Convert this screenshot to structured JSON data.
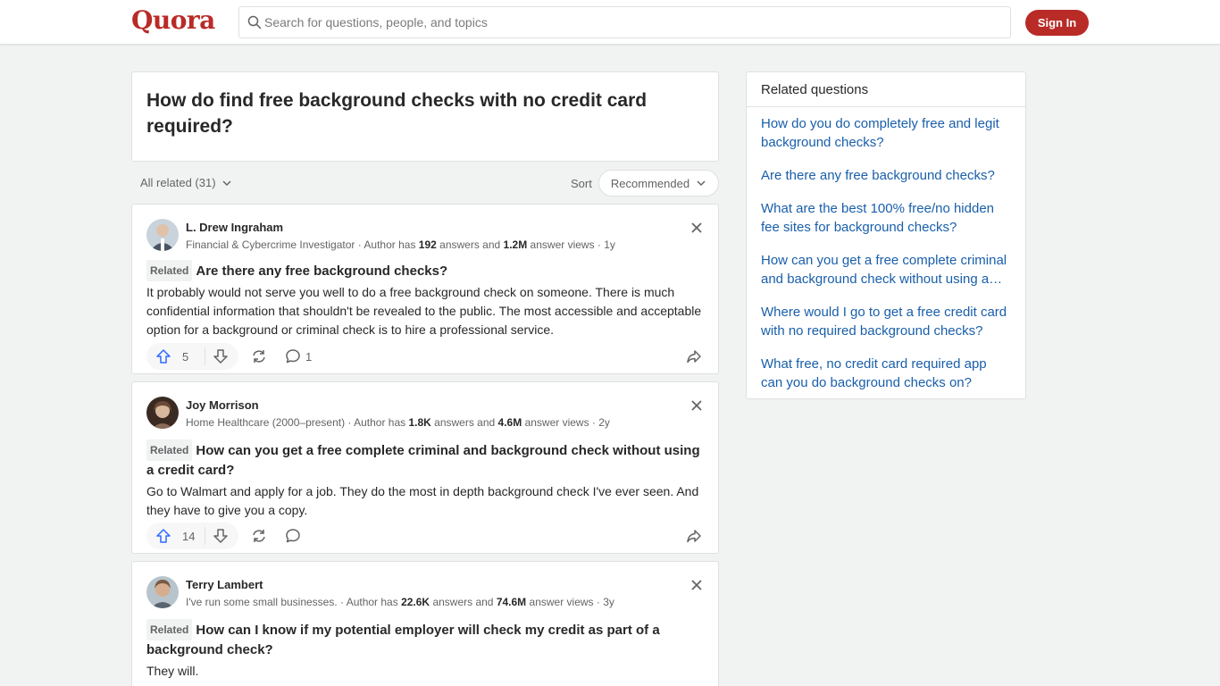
{
  "header": {
    "logo": "Quora",
    "search_placeholder": "Search for questions, people, and topics",
    "signin_label": "Sign In"
  },
  "question": {
    "title": "How do find free background checks with no credit card required?"
  },
  "filters": {
    "all_related": "All related (31)",
    "sort_label": "Sort",
    "sort_value": "Recommended"
  },
  "answers": [
    {
      "author": "L. Drew Ingraham",
      "cred_pre": "Financial & Cybercrime Investigator · Author has ",
      "answers_count": "192",
      "cred_mid": " answers and ",
      "views_count": "1.2M",
      "cred_post": " answer views · 1y",
      "tag": "Related",
      "related_question": "Are there any free background checks?",
      "body": "It probably would not serve you well to do a free background check on someone. There is much confidential information that shouldn't be revealed to the public. The most accessible and acceptable option for a background or criminal check is to hire a professional service.",
      "upvotes": "5",
      "comments": "1"
    },
    {
      "author": "Joy Morrison",
      "cred_pre": "Home Healthcare (2000–present) · Author has ",
      "answers_count": "1.8K",
      "cred_mid": " answers and ",
      "views_count": "4.6M",
      "cred_post": " answer views · 2y",
      "tag": "Related",
      "related_question": "How can you get a free complete criminal and background check without using a credit card?",
      "body": "Go to Walmart and apply for a job. They do the most in depth background check I've ever seen. And they have to give you a copy.",
      "upvotes": "14",
      "comments": ""
    },
    {
      "author": "Terry Lambert",
      "cred_pre": "I've run some small businesses. · Author has ",
      "answers_count": "22.6K",
      "cred_mid": " answers and ",
      "views_count": "74.6M",
      "cred_post": " answer views · 3y",
      "tag": "Related",
      "related_question": "How can I know if my potential employer will check my credit as part of a background check?",
      "body": "They will.",
      "upvotes": "",
      "comments": ""
    }
  ],
  "related_questions": {
    "heading": "Related questions",
    "items": [
      "How do you do completely free and legit background checks?",
      "Are there any free background checks?",
      "What are the best 100% free/no hidden fee sites for background checks?",
      "How can you get a free complete criminal and background check without using a…",
      "Where would I go to get a free credit card with no required background checks?",
      "What free, no credit card required app can you do background checks on?"
    ]
  },
  "colors": {
    "brand": "#b92b27",
    "link": "#195faa",
    "upvote": "#2e69ff"
  }
}
